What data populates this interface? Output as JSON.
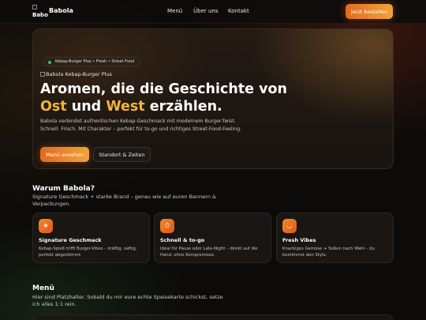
{
  "nav": {
    "logo_alt": "Babo",
    "brand": "Babola",
    "links": [
      "Menü",
      "Über uns",
      "Kontakt"
    ],
    "cta": "Jetzt bestellen"
  },
  "hero": {
    "chip": "Kebap-Burger Plus • Fresh • Street Food",
    "image_alt": "Babola Kebap-Burger Plus",
    "title_line1": "Aromen, die die Geschichte von",
    "title_ost": "Ost",
    "title_und": " und ",
    "title_west": "West",
    "title_end": " erzählen.",
    "description": "Babola verbindet authentischen Kebap-Geschmack mit modernem Burger-Twist. Schnell. Frisch. Mit Charakter – perfekt für to-go und richtiges Street-Food-Feeling.",
    "primary_button": "Menü ansehen",
    "secondary_button": "Standort & Zeiten"
  },
  "why": {
    "title": "Warum Babola?",
    "subtitle": "Signature Geschmack + starke Brand – genau wie auf euren Bannern & Verpackungen.",
    "cards": [
      {
        "icon": "star-icon",
        "glyph": "★",
        "title": "Signature Geschmack",
        "desc": "Kebap-Spieß trifft Burger-Vibes – kräftig, saftig, perfekt abgestimmt."
      },
      {
        "icon": "clock-icon",
        "glyph": "⏱",
        "title": "Schnell & to-go",
        "desc": "Ideal für Pause oder Late-Night – direkt auf die Hand, ohne Kompromisse."
      },
      {
        "icon": "bowl-icon",
        "glyph": "◡",
        "title": "Fresh Vibes",
        "desc": "Knackiges Gemüse + Soßen nach Wahl – du bestimmst den Style."
      }
    ]
  },
  "menu": {
    "title": "Menü",
    "subtitle": "Hier sind Platzhalter. Sobald du mir eure echte Speisekarte schickst, setze ich alles 1:1 rein."
  },
  "colors": {
    "accent": "#f2b53a",
    "cta_start": "#e26a1e",
    "cta_end": "#f2a33a",
    "status_dot": "#3fbf5a"
  }
}
